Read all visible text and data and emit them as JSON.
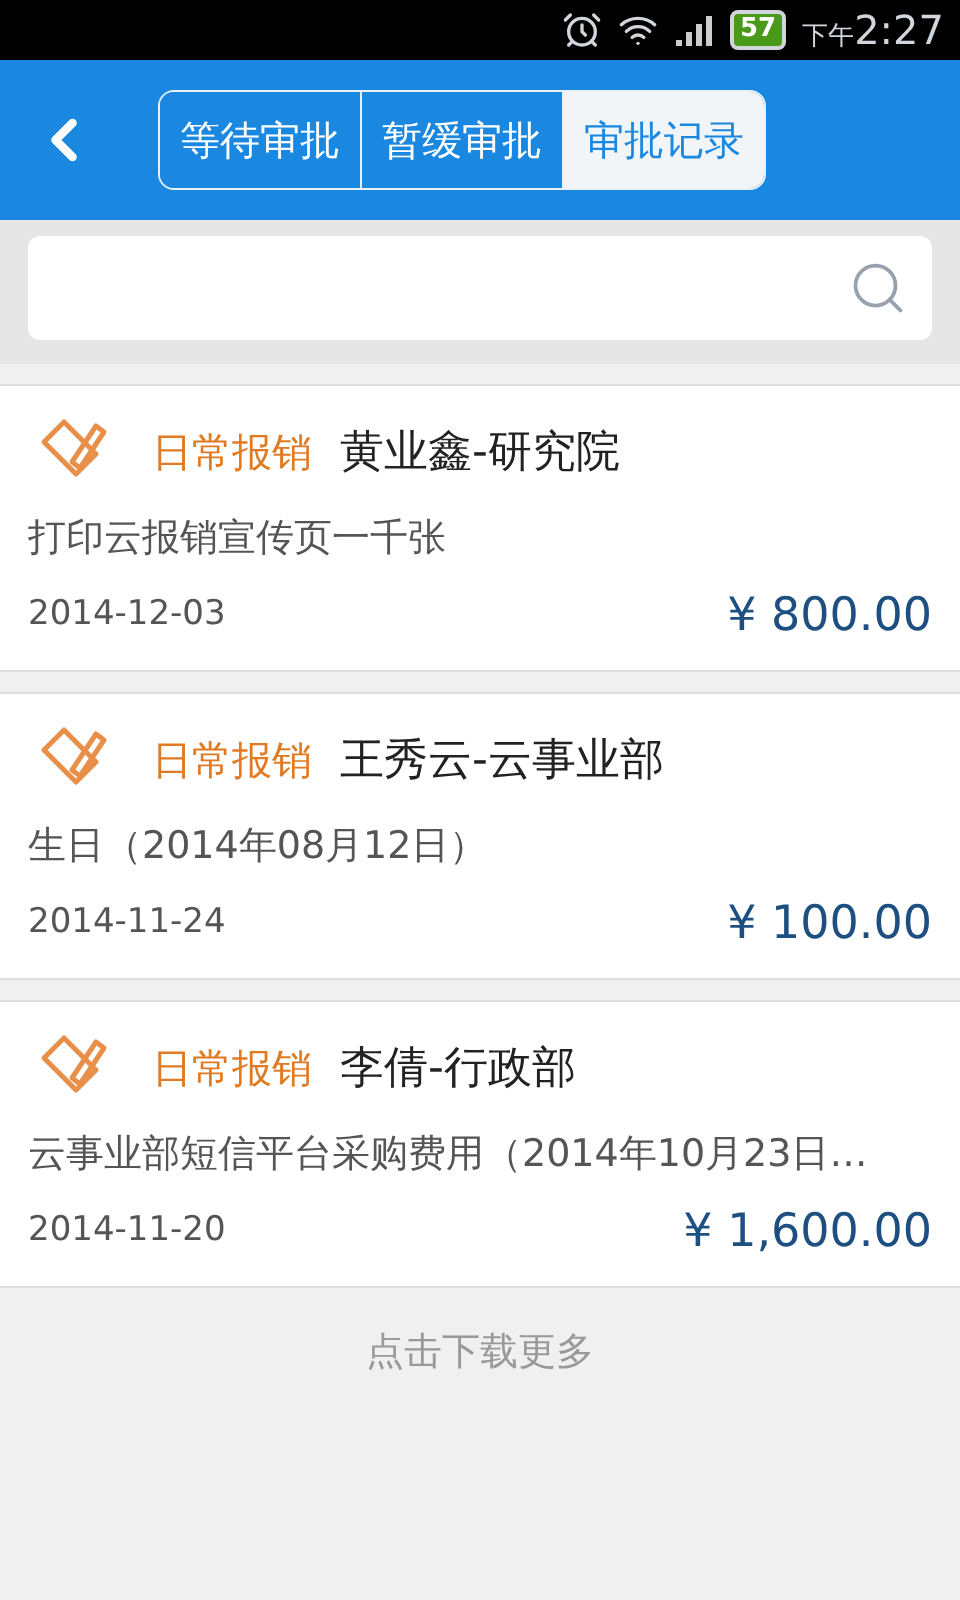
{
  "status_bar": {
    "battery": "57",
    "time_prefix": "下午",
    "time": "2:27"
  },
  "tabs": [
    {
      "label": "等待审批",
      "selected": false
    },
    {
      "label": "暂缓审批",
      "selected": false
    },
    {
      "label": "审批记录",
      "selected": true
    }
  ],
  "records": [
    {
      "category": "日常报销",
      "person": "黄业鑫-研究院",
      "description": "打印云报销宣传页一千张",
      "date": "2014-12-03",
      "amount": "¥ 800.00"
    },
    {
      "category": "日常报销",
      "person": "王秀云-云事业部",
      "description": "生日（2014年08月12日）",
      "date": "2014-11-24",
      "amount": "¥ 100.00"
    },
    {
      "category": "日常报销",
      "person": "李倩-行政部",
      "description": "云事业部短信平台采购费用（2014年10月23日…",
      "date": "2014-11-20",
      "amount": "¥ 1,600.00"
    }
  ],
  "load_more": "点击下载更多"
}
